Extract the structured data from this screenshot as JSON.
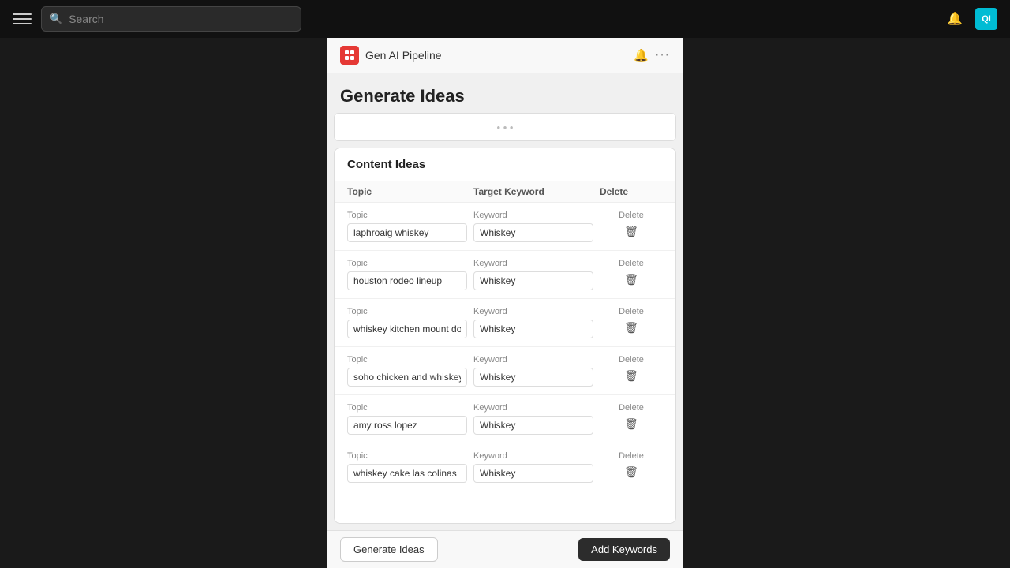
{
  "nav": {
    "search_placeholder": "Search",
    "avatar_text": "QI"
  },
  "panel": {
    "title": "Gen AI Pipeline",
    "generate_title": "Generate Ideas"
  },
  "content_ideas": {
    "section_title": "Content Ideas",
    "columns": {
      "topic": "Topic",
      "keyword": "Target Keyword",
      "delete": "Delete"
    },
    "rows": [
      {
        "topic_label": "Topic",
        "topic_value": "laphroaig whiskey",
        "keyword_label": "Keyword",
        "keyword_value": "Whiskey",
        "delete_label": "Delete"
      },
      {
        "topic_label": "Topic",
        "topic_value": "houston rodeo lineup",
        "keyword_label": "Keyword",
        "keyword_value": "Whiskey",
        "delete_label": "Delete"
      },
      {
        "topic_label": "Topic",
        "topic_value": "whiskey kitchen mount dora",
        "keyword_label": "Keyword",
        "keyword_value": "Whiskey",
        "delete_label": "Delete"
      },
      {
        "topic_label": "Topic",
        "topic_value": "soho chicken and whiskey",
        "keyword_label": "Keyword",
        "keyword_value": "Whiskey",
        "delete_label": "Delete"
      },
      {
        "topic_label": "Topic",
        "topic_value": "amy ross lopez",
        "keyword_label": "Keyword",
        "keyword_value": "Whiskey",
        "delete_label": "Delete"
      },
      {
        "topic_label": "Topic",
        "topic_value": "whiskey cake las colinas",
        "keyword_label": "Keyword",
        "keyword_value": "Whiskey",
        "delete_label": "Delete"
      }
    ]
  },
  "buttons": {
    "generate": "Generate Ideas",
    "add_keywords": "Add Keywords"
  }
}
